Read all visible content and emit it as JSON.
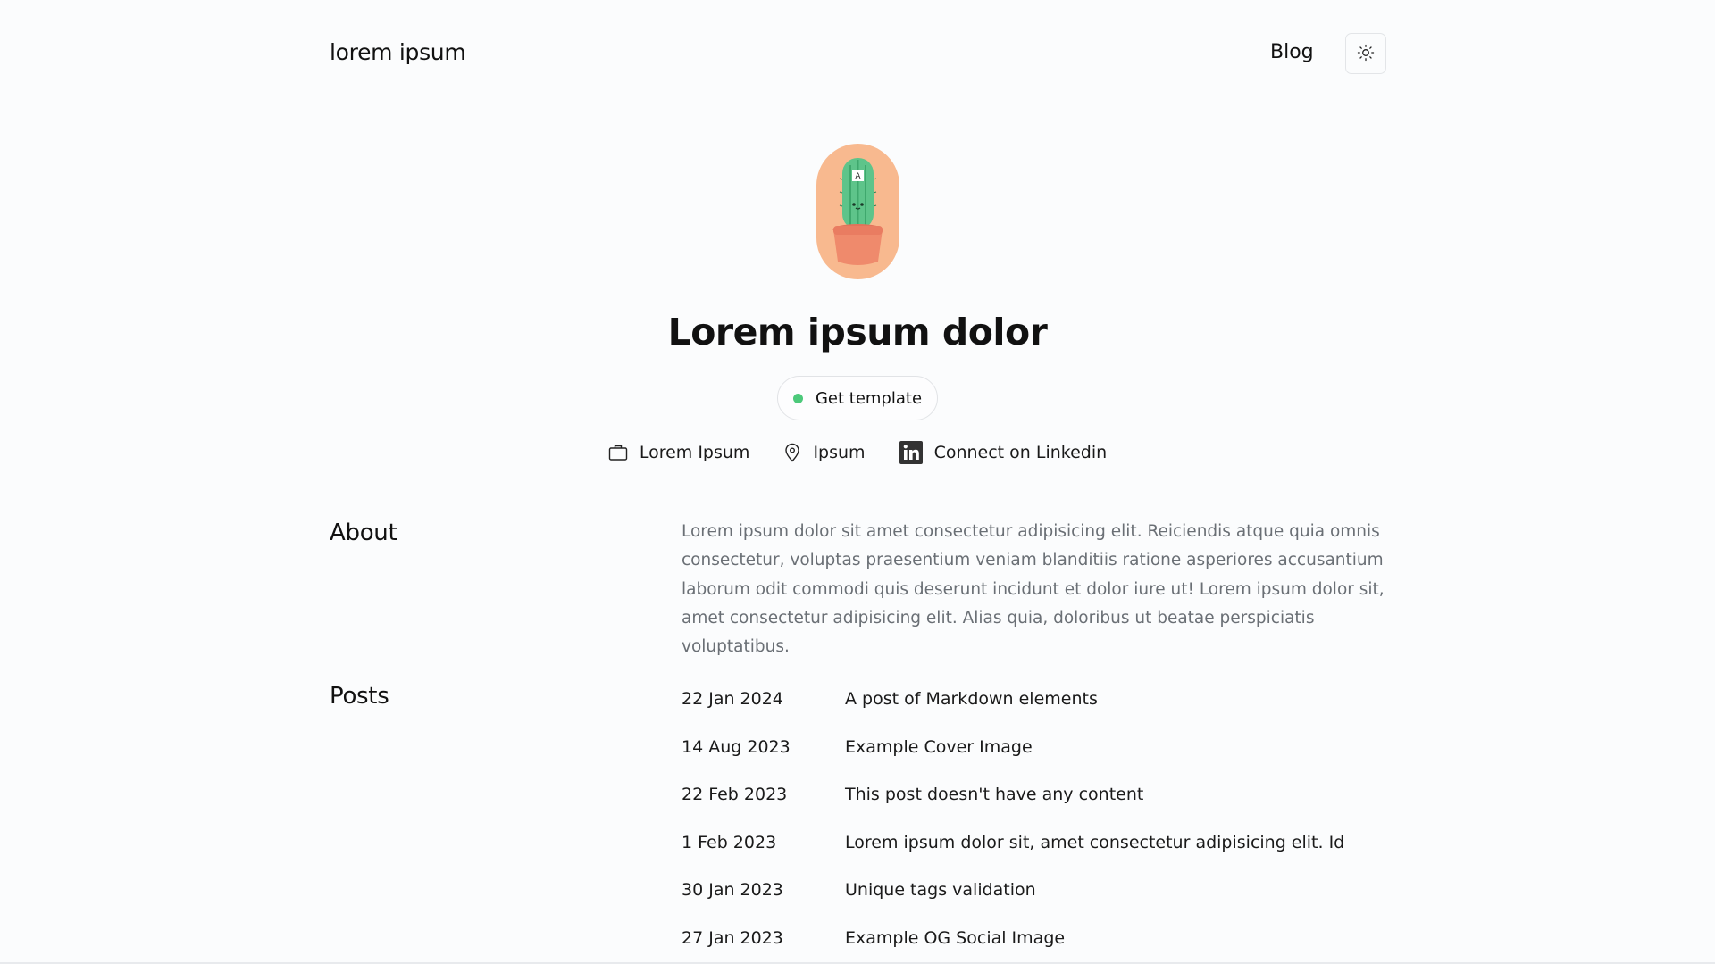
{
  "header": {
    "site_title": "lorem ipsum",
    "nav_blog": "Blog",
    "theme_icon": "sun-icon"
  },
  "hero": {
    "avatar_icon": "cactus-avatar",
    "title": "Lorem ipsum dolor",
    "cta_label": "Get template",
    "status_color": "#4cc97a",
    "meta": [
      {
        "icon": "briefcase-icon",
        "label": "Lorem Ipsum"
      },
      {
        "icon": "location-pin-icon",
        "label": "Ipsum"
      },
      {
        "icon": "linkedin-icon",
        "label": "Connect on Linkedin"
      }
    ]
  },
  "about": {
    "heading": "About",
    "text": "Lorem ipsum dolor sit amet consectetur adipisicing elit. Reiciendis atque quia omnis consectetur, voluptas praesentium veniam blanditiis ratione asperiores accusantium laborum odit commodi quis deserunt incidunt et dolor iure ut! Lorem ipsum dolor sit, amet consectetur adipisicing elit. Alias quia, doloribus ut beatae perspiciatis voluptatibus."
  },
  "posts": {
    "heading": "Posts",
    "items": [
      {
        "date": "22 Jan 2024",
        "title": "A post of Markdown elements"
      },
      {
        "date": "14 Aug 2023",
        "title": "Example Cover Image"
      },
      {
        "date": "22 Feb 2023",
        "title": "This post doesn't have any content"
      },
      {
        "date": "1 Feb 2023",
        "title": "Lorem ipsum dolor sit, amet consectetur adipisicing elit. Id"
      },
      {
        "date": "30 Jan 2023",
        "title": "Unique tags validation"
      },
      {
        "date": "27 Jan 2023",
        "title": "Example OG Social Image"
      }
    ]
  }
}
